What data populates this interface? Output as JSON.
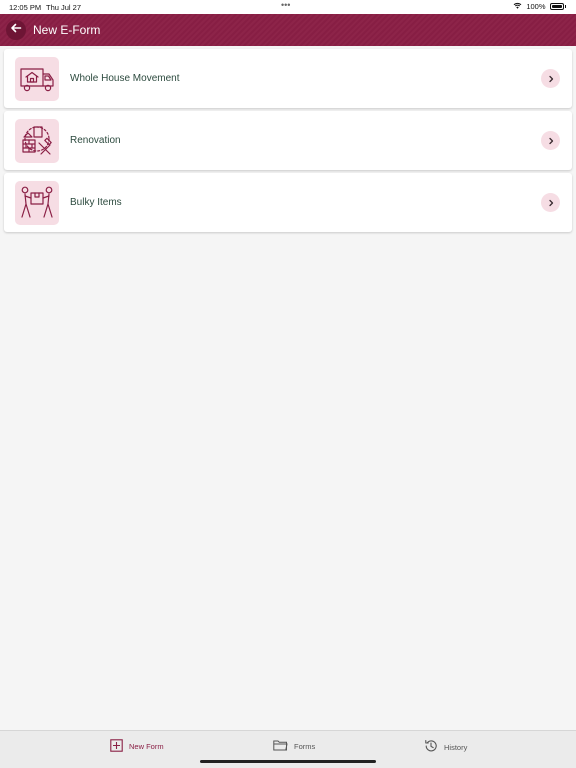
{
  "status_bar": {
    "time": "12:05 PM",
    "date": "Thu Jul 27",
    "dots": "•••",
    "battery": "100%"
  },
  "header": {
    "title": "New E-Form"
  },
  "items": [
    {
      "label": "Whole House Movement",
      "icon": "moving-truck-house-icon"
    },
    {
      "label": "Renovation",
      "icon": "renovation-tools-icon"
    },
    {
      "label": "Bulky Items",
      "icon": "people-carrying-box-icon"
    }
  ],
  "tabs": [
    {
      "label": "New Form",
      "icon": "plus-square-icon",
      "active": true
    },
    {
      "label": "Forms",
      "icon": "folder-icon",
      "active": false
    },
    {
      "label": "History",
      "icon": "history-icon",
      "active": false
    }
  ],
  "colors": {
    "brand": "#8a1f45",
    "icon_bg": "#f6dde4",
    "label": "#2c4a3e"
  }
}
